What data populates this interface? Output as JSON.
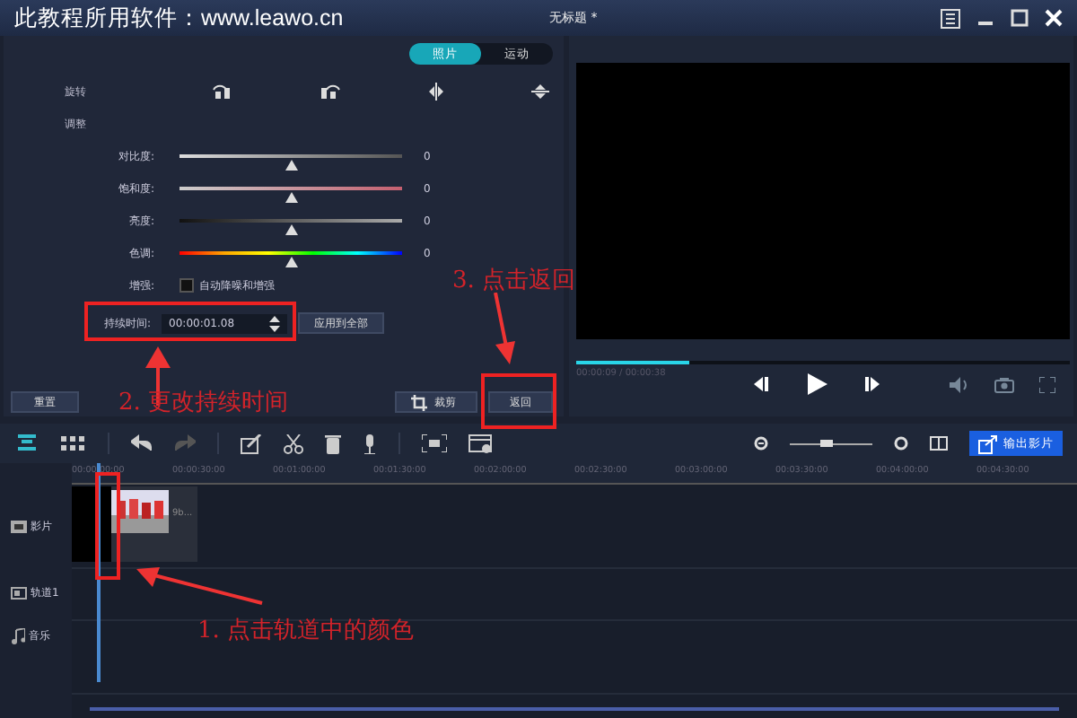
{
  "window": {
    "banner": "此教程所用软件：www.leawo.cn",
    "title": "无标题 *"
  },
  "tabs": [
    {
      "label": "照片",
      "selected": true
    },
    {
      "label": "运动",
      "selected": false
    }
  ],
  "rotate_label": "旋转",
  "adjust_label": "调整",
  "sliders": [
    {
      "label": "对比度:",
      "kind": "gray",
      "level": 0.5,
      "reading": "0"
    },
    {
      "label": "饱和度:",
      "kind": "saturation",
      "level": 0.5,
      "reading": "0"
    },
    {
      "label": "亮度:",
      "kind": "brightness",
      "level": 0.5,
      "reading": "0"
    },
    {
      "label": "色调:",
      "kind": "hue",
      "level": 0.5,
      "reading": "0"
    }
  ],
  "enhance": {
    "label": "增强:",
    "option": "自动降噪和增强",
    "checked": false
  },
  "duration": {
    "label": "持续时间:",
    "value": "00:00:01.08"
  },
  "apply_all": "应用到全部",
  "reset": "重置",
  "crop": "裁剪",
  "back": "返回",
  "player": {
    "time": "00:00:09 / 00:00:38",
    "level": 0.23
  },
  "zoom": {
    "level": 0.45
  },
  "export": "输出影片",
  "ruler": [
    "00:00:00:00",
    "00:00:30:00",
    "00:01:00:00",
    "00:01:30:00",
    "00:02:00:00",
    "00:02:30:00",
    "00:03:00:00",
    "00:03:30:00",
    "00:04:00:00",
    "00:04:30:00"
  ],
  "tracks": [
    {
      "label": "影片",
      "kind": "video"
    },
    {
      "label": "轨道1",
      "kind": "overlay"
    },
    {
      "label": "音乐",
      "kind": "music"
    }
  ],
  "clip": {
    "label": "9b..."
  },
  "annotations": [
    {
      "text": "1. 点击轨道中的颜色"
    },
    {
      "text": "2. 更改持续时间"
    },
    {
      "text": "3. 点击返回"
    }
  ]
}
